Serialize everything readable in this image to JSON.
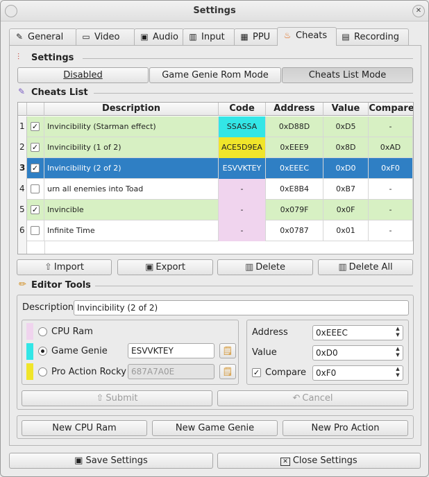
{
  "window": {
    "title": "Settings",
    "close_glyph": "✕"
  },
  "tabs": [
    {
      "label": "General",
      "icon": "wrench-icon"
    },
    {
      "label": "Video",
      "icon": "monitor-icon"
    },
    {
      "label": "Audio",
      "icon": "speaker-icon"
    },
    {
      "label": "Input",
      "icon": "gamepad-icon"
    },
    {
      "label": "PPU",
      "icon": "chip-icon"
    },
    {
      "label": "Cheats",
      "icon": "flame-icon"
    },
    {
      "label": "Recording",
      "icon": "clapper-icon"
    }
  ],
  "settings_section": {
    "title": "Settings",
    "modes": [
      "Disabled",
      "Game Genie Rom Mode",
      "Cheats List Mode"
    ],
    "selected_mode": "Cheats List Mode"
  },
  "cheats_list": {
    "title": "Cheats List",
    "columns": [
      "Description",
      "Code",
      "Address",
      "Value",
      "Compare"
    ],
    "rows": [
      {
        "num": "1",
        "checked": true,
        "description": "Invincibility (Starman effect)",
        "code": "SSASSA",
        "address": "0xD88D",
        "value": "0xD5",
        "compare": "-",
        "row_color": "#d7f0c3",
        "code_color": "#33e6e6"
      },
      {
        "num": "2",
        "checked": true,
        "description": "Invincibility (1 of 2)",
        "code": "ACE5D9EA",
        "address": "0xEEE9",
        "value": "0x8D",
        "compare": "0xAD",
        "row_color": "#d7f0c3",
        "code_color": "#f0e52a"
      },
      {
        "num": "3",
        "checked": true,
        "description": "Invincibility (2 of 2)",
        "code": "ESVVKTEY",
        "address": "0xEEEC",
        "value": "0xD0",
        "compare": "0xF0",
        "row_color": "#2f7fc4",
        "code_color": "#2f7fc4",
        "selected": true
      },
      {
        "num": "4",
        "checked": false,
        "description": "urn all enemies into Toad",
        "code": "-",
        "address": "0xE8B4",
        "value": "0xB7",
        "compare": "-",
        "row_color": "#ffffff",
        "code_color": "#f0d4ee"
      },
      {
        "num": "5",
        "checked": true,
        "description": "Invincible",
        "code": "-",
        "address": "0x079F",
        "value": "0x0F",
        "compare": "-",
        "row_color": "#d7f0c3",
        "code_color": "#f0d4ee"
      },
      {
        "num": "6",
        "checked": false,
        "description": "Infinite Time",
        "code": "-",
        "address": "0x0787",
        "value": "0x01",
        "compare": "-",
        "row_color": "#ffffff",
        "code_color": "#f0d4ee"
      }
    ]
  },
  "list_actions": {
    "import": "Import",
    "export": "Export",
    "delete": "Delete",
    "delete_all": "Delete All"
  },
  "editor": {
    "title": "Editor Tools",
    "description_label": "Description",
    "description_value": "Invincibility (2 of 2)",
    "cpu_ram_label": "CPU Ram",
    "game_genie_label": "Game Genie",
    "game_genie_value": "ESVVKTEY",
    "pro_action_label": "Pro Action Rocky",
    "pro_action_value": "687A7A0E",
    "selected_type": "Game Genie",
    "address_label": "Address",
    "address_value": "0xEEEC",
    "value_label": "Value",
    "value_value": "0xD0",
    "compare_label": "Compare",
    "compare_checked": true,
    "compare_value": "0xF0",
    "submit": "Submit",
    "cancel": "Cancel",
    "swatches": {
      "cpu_ram": "#f0d4ee",
      "game_genie": "#33e6e6",
      "pro_action": "#f0e52a"
    }
  },
  "new_buttons": {
    "cpu_ram": "New CPU Ram",
    "game_genie": "New Game Genie",
    "pro_action": "New Pro Action"
  },
  "footer": {
    "save": "Save Settings",
    "close": "Close Settings"
  }
}
